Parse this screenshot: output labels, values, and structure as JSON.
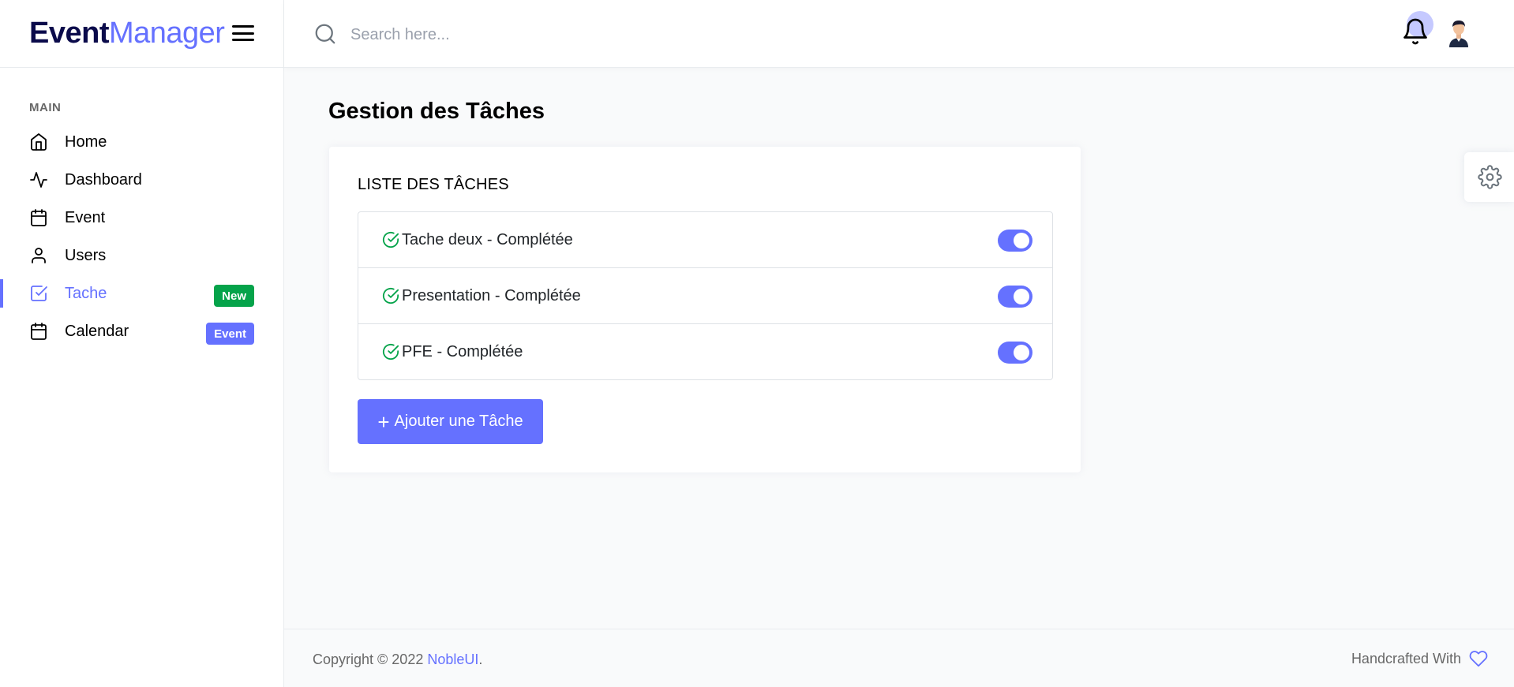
{
  "brand": {
    "strong": "Event",
    "light": "Manager"
  },
  "search": {
    "placeholder": "Search here..."
  },
  "sidebar": {
    "category": "MAIN",
    "items": [
      {
        "label": "Home",
        "icon": "home-icon"
      },
      {
        "label": "Dashboard",
        "icon": "activity-icon"
      },
      {
        "label": "Event",
        "icon": "calendar-icon"
      },
      {
        "label": "Users",
        "icon": "user-icon"
      },
      {
        "label": "Tache",
        "icon": "check-square-icon",
        "active": true,
        "badge": "New"
      },
      {
        "label": "Calendar",
        "icon": "calendar-icon",
        "badge": "Event"
      }
    ]
  },
  "main": {
    "title": "Gestion des Tâches",
    "card_title": "LISTE DES TÂCHES",
    "tasks": [
      {
        "text": "Tache deux - Complétée",
        "done": true
      },
      {
        "text": "Presentation - Complétée",
        "done": true
      },
      {
        "text": "PFE - Complétée",
        "done": true
      }
    ],
    "add_button_label": "Ajouter une Tâche"
  },
  "footer": {
    "copyright": "Copyright © 2022 ",
    "link": "NobleUI",
    "period": ".",
    "right_text": "Handcrafted With"
  },
  "colors": {
    "accent": "#6571ff",
    "badge_new": "#05a34a",
    "brand_dark": "#0b0b4b"
  }
}
